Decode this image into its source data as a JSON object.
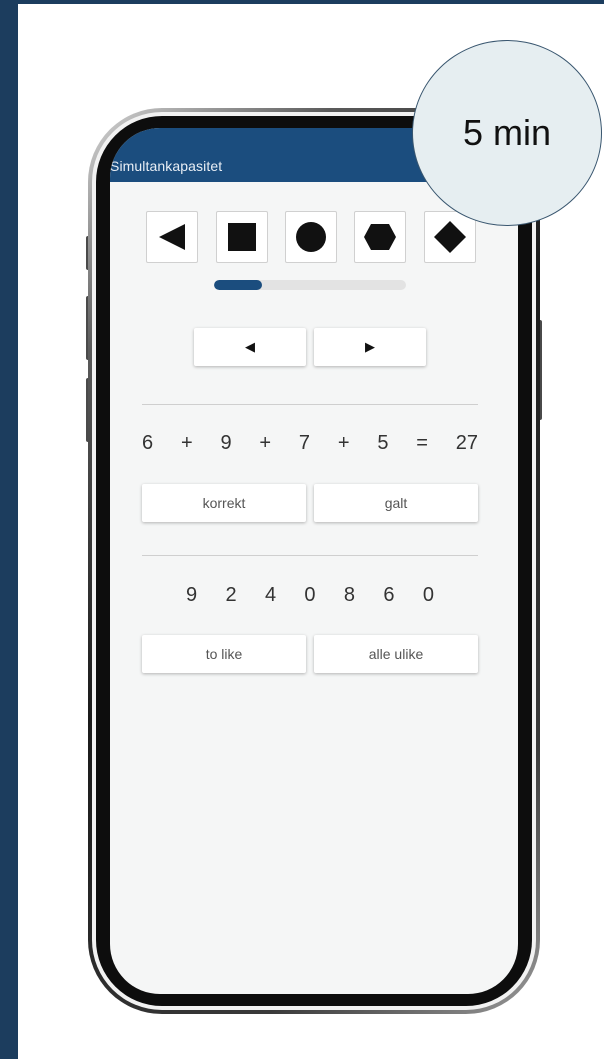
{
  "app": {
    "title": "Simultankapasitet"
  },
  "shapes": [
    {
      "icon": "triangle-left-icon"
    },
    {
      "icon": "square-icon"
    },
    {
      "icon": "circle-icon"
    },
    {
      "icon": "hexagon-icon"
    },
    {
      "icon": "diamond-icon"
    }
  ],
  "progress": {
    "fraction": 0.25
  },
  "nav": {
    "prev_label": "◀",
    "next_label": "▶"
  },
  "equation": {
    "terms": [
      "6",
      "+",
      "9",
      "+",
      "7",
      "+",
      "5",
      "=",
      "27"
    ]
  },
  "equation_answers": {
    "correct_label": "korrekt",
    "wrong_label": "galt"
  },
  "digits": {
    "values": [
      "9",
      "2",
      "4",
      "0",
      "8",
      "6",
      "0"
    ]
  },
  "digit_answers": {
    "two_same_label": "to like",
    "all_different_label": "alle ulike"
  },
  "timer": {
    "label": "5 min"
  },
  "colors": {
    "primary": "#1b4d7e",
    "frame": "#1c3d5e",
    "screen_bg": "#f5f6f6",
    "timer_bg": "#e6eef1"
  }
}
